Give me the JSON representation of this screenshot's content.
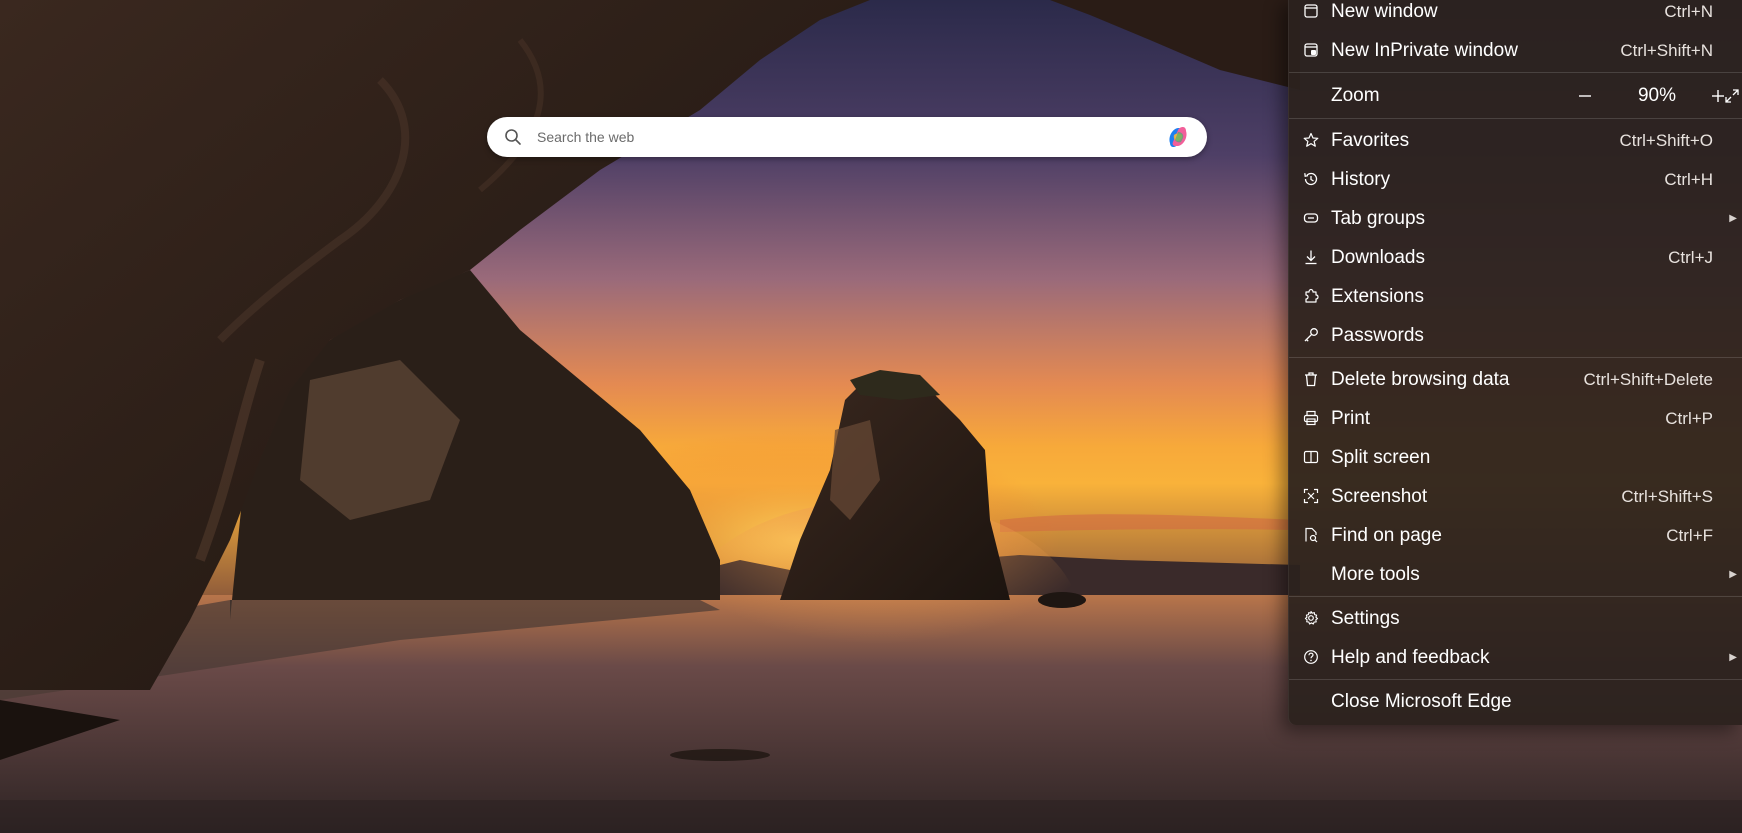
{
  "search": {
    "placeholder": "Search the web"
  },
  "menu": {
    "new_window": {
      "label": "New window",
      "shortcut": "Ctrl+N"
    },
    "new_inprivate": {
      "label": "New InPrivate window",
      "shortcut": "Ctrl+Shift+N"
    },
    "zoom": {
      "label": "Zoom",
      "value": "90%",
      "decrease": "—",
      "increase": "+"
    },
    "favorites": {
      "label": "Favorites",
      "shortcut": "Ctrl+Shift+O"
    },
    "history": {
      "label": "History",
      "shortcut": "Ctrl+H"
    },
    "tab_groups": {
      "label": "Tab groups"
    },
    "downloads": {
      "label": "Downloads",
      "shortcut": "Ctrl+J"
    },
    "extensions": {
      "label": "Extensions"
    },
    "passwords": {
      "label": "Passwords"
    },
    "delete_browsing_data": {
      "label": "Delete browsing data",
      "shortcut": "Ctrl+Shift+Delete"
    },
    "print": {
      "label": "Print",
      "shortcut": "Ctrl+P"
    },
    "split_screen": {
      "label": "Split screen"
    },
    "screenshot": {
      "label": "Screenshot",
      "shortcut": "Ctrl+Shift+S"
    },
    "find_on_page": {
      "label": "Find on page",
      "shortcut": "Ctrl+F"
    },
    "more_tools": {
      "label": "More tools"
    },
    "settings": {
      "label": "Settings"
    },
    "help_feedback": {
      "label": "Help and feedback"
    },
    "close_edge": {
      "label": "Close Microsoft Edge"
    }
  },
  "icons": {
    "search": "search-icon",
    "copilot": "copilot-icon",
    "new_window": "window-icon",
    "new_inprivate": "inprivate-window-icon",
    "favorites": "star-icon",
    "history": "history-icon",
    "tab_groups": "tab-groups-icon",
    "downloads": "download-icon",
    "extensions": "puzzle-icon",
    "passwords": "key-icon",
    "delete_browsing_data": "trash-icon",
    "print": "printer-icon",
    "split_screen": "split-screen-icon",
    "screenshot": "screenshot-icon",
    "find_on_page": "find-icon",
    "settings": "gear-icon",
    "help_feedback": "help-icon",
    "fullscreen": "expand-icon",
    "submenu": "chevron-right-icon"
  },
  "colors": {
    "menu_background": "#2c221e",
    "menu_text": "#ffffff",
    "search_background": "#ffffff"
  }
}
